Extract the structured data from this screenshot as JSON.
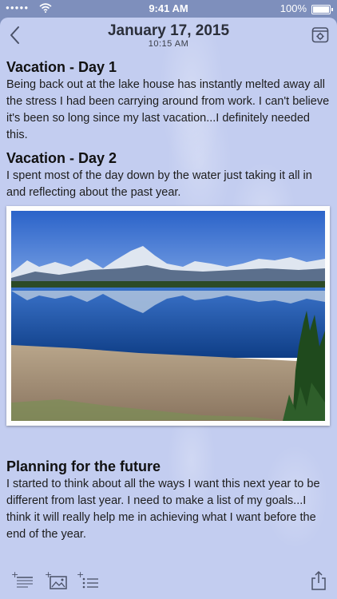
{
  "status_bar": {
    "time": "9:41 AM",
    "battery": "100%"
  },
  "header": {
    "date": "January 17, 2015",
    "time": "10:15 AM"
  },
  "entries": [
    {
      "title": "Vacation - Day 1",
      "body": "Being back out at the lake house has instantly melted away all the stress I had been carrying around from work. I can't believe it's been so long since my last vacation...I definitely needed this."
    },
    {
      "title": "Vacation - Day 2",
      "body": "I spent most of the day down by the water just taking it all in and reflecting about the past year."
    },
    {
      "title": "Planning for the future",
      "body": "I started to think about all the ways I want this next year to be different from last year.  I need to make a list of my goals...I think it will really help me in achieving what I want before the end of the year."
    }
  ],
  "colors": {
    "status_bar_bg": "#7e8fbc",
    "page_bg": "#c3cdf0",
    "icon": "#4a5167"
  },
  "icons": {
    "back": "chevron-left-icon",
    "calendar": "calendar-gear-icon",
    "add_text": "add-text-icon",
    "add_photo": "add-photo-icon",
    "add_list": "add-list-icon",
    "share": "share-icon"
  }
}
